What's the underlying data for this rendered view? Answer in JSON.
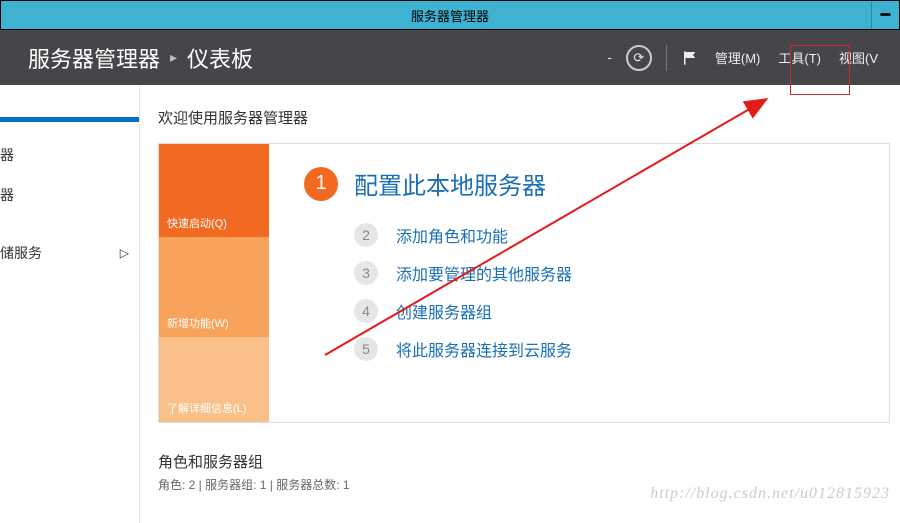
{
  "titlebar": {
    "title": "服务器管理器"
  },
  "header": {
    "crumb1": "服务器管理器",
    "crumb2": "仪表板",
    "dash": "-",
    "menu_manage": "管理(M)",
    "menu_tools": "工具(T)",
    "menu_view": "视图(V"
  },
  "sidebar": {
    "items": [
      {
        "label": "器"
      },
      {
        "label": "器"
      },
      {
        "label": "储服务",
        "has_chevron": true
      }
    ]
  },
  "main": {
    "welcome": "欢迎使用服务器管理器",
    "left_segments": {
      "seg1": "快速启动(Q)",
      "seg2": "新增功能(W)",
      "seg3": "了解详细信息(L)"
    },
    "steps": {
      "s1": {
        "num": "1",
        "label": "配置此本地服务器"
      },
      "s2": {
        "num": "2",
        "label": "添加角色和功能"
      },
      "s3": {
        "num": "3",
        "label": "添加要管理的其他服务器"
      },
      "s4": {
        "num": "4",
        "label": "创建服务器组"
      },
      "s5": {
        "num": "5",
        "label": "将此服务器连接到云服务"
      }
    },
    "section2": {
      "title": "角色和服务器组",
      "subtitle": "角色: 2 | 服务器组: 1 | 服务器总数: 1"
    }
  },
  "watermark": "http://blog.csdn.net/u012815923"
}
